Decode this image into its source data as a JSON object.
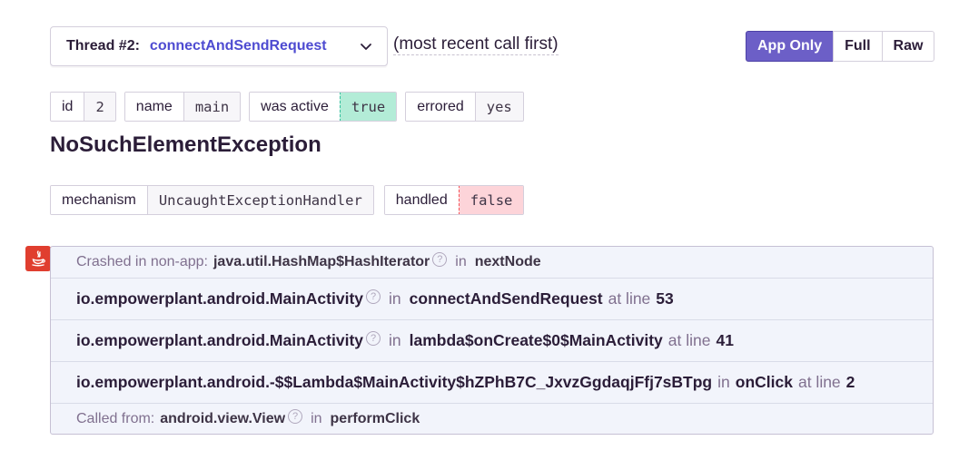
{
  "thread_selector": {
    "prefix": "Thread #2:",
    "name": "connectAndSendRequest",
    "order_note": "(most recent call first)"
  },
  "view_modes": {
    "active": "App Only",
    "options": [
      "App Only",
      "Full",
      "Raw"
    ]
  },
  "thread_tags": [
    {
      "key": "id",
      "value": "2"
    },
    {
      "key": "name",
      "value": "main"
    },
    {
      "key": "was active",
      "value": "true"
    },
    {
      "key": "errored",
      "value": "yes"
    }
  ],
  "exception": {
    "type": "NoSuchElementException",
    "mechanism_tags": [
      {
        "key": "mechanism",
        "value": "UncaughtExceptionHandler"
      },
      {
        "key": "handled",
        "value": "false"
      }
    ]
  },
  "platform_icon": "java-icon",
  "frames": {
    "crashed": {
      "label": "Crashed in non-app:",
      "module": "java.util.HashMap$HashIterator",
      "in": "in",
      "function": "nextNode"
    },
    "items": [
      {
        "module": "io.empowerplant.android.MainActivity",
        "in": "in",
        "function": "connectAndSendRequest",
        "line_label": "at line",
        "line": "53"
      },
      {
        "module": "io.empowerplant.android.MainActivity",
        "in": "in",
        "function": "lambda$onCreate$0$MainActivity",
        "line_label": "at line",
        "line": "41"
      },
      {
        "module": "io.empowerplant.android.-$$Lambda$MainActivity$hZPhB7C_JxvzGgdaqjFfj7sBTpg",
        "in": "in",
        "function": "onClick",
        "line_label": "at line",
        "line": "2"
      }
    ],
    "called_from": {
      "label": "Called from:",
      "module": "android.view.View",
      "in": "in",
      "function": "performClick"
    }
  },
  "help_icon": "question-circle-icon",
  "colors": {
    "accent": "#6c5fc7",
    "link": "#4e4bd1",
    "success": "#b3ecd7",
    "error": "#fdd4d9",
    "java_brand": "#e03e2f"
  }
}
